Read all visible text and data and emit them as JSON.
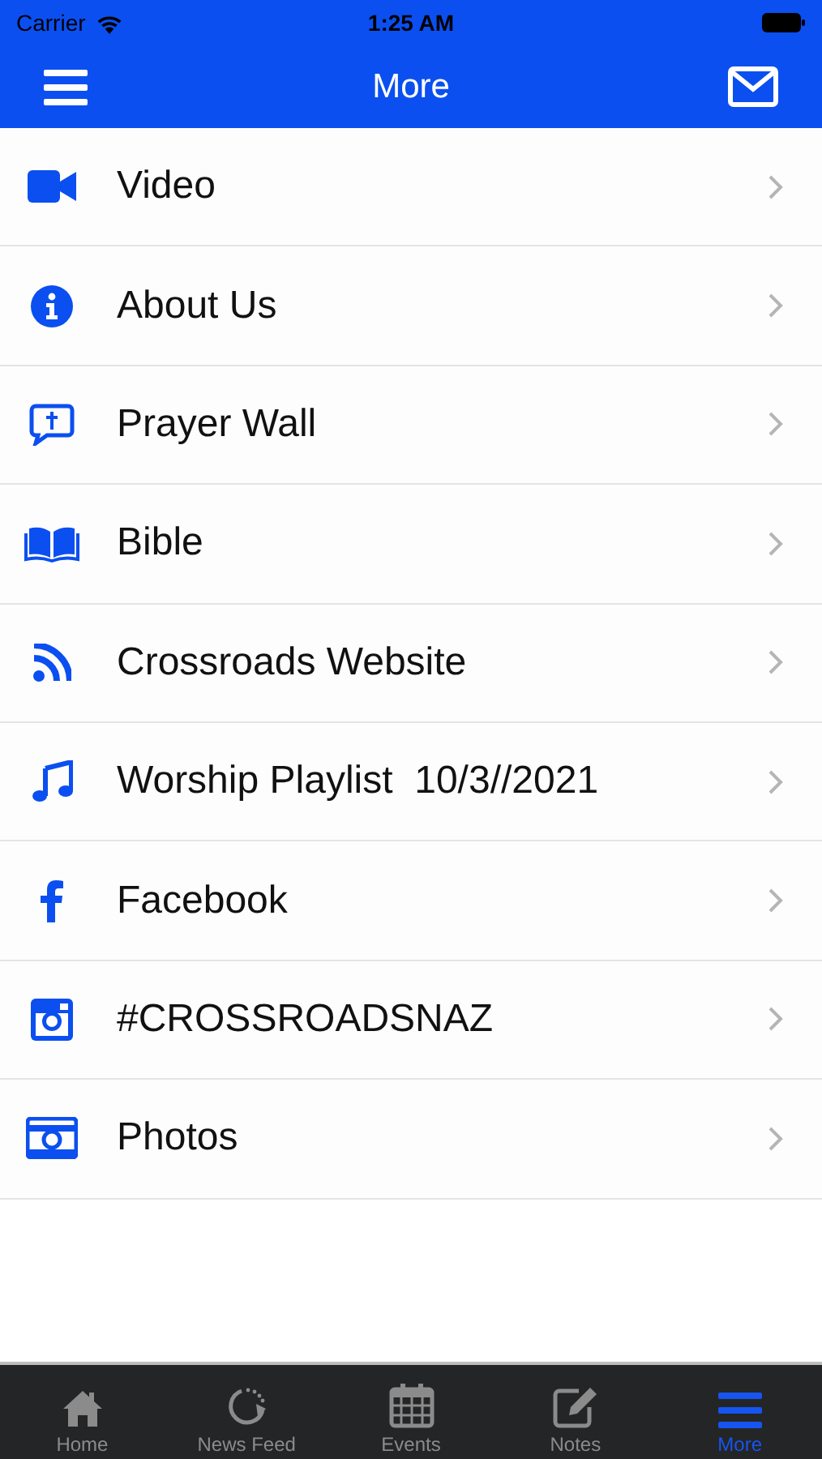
{
  "status_bar": {
    "carrier": "Carrier",
    "time": "1:25 AM"
  },
  "nav_bar": {
    "title": "More"
  },
  "menu": [
    {
      "label": "Video"
    },
    {
      "label": "About Us"
    },
    {
      "label": "Prayer Wall"
    },
    {
      "label": "Bible"
    },
    {
      "label": "Crossroads Website"
    },
    {
      "label": "Worship Playlist  10/3//2021"
    },
    {
      "label": "Facebook"
    },
    {
      "label": "#CROSSROADSNAZ"
    },
    {
      "label": "Photos"
    }
  ],
  "tab_bar": [
    {
      "label": "Home",
      "selected": false
    },
    {
      "label": "News Feed",
      "selected": false
    },
    {
      "label": "Events",
      "selected": false
    },
    {
      "label": "Notes",
      "selected": false
    },
    {
      "label": "More",
      "selected": true
    }
  ]
}
